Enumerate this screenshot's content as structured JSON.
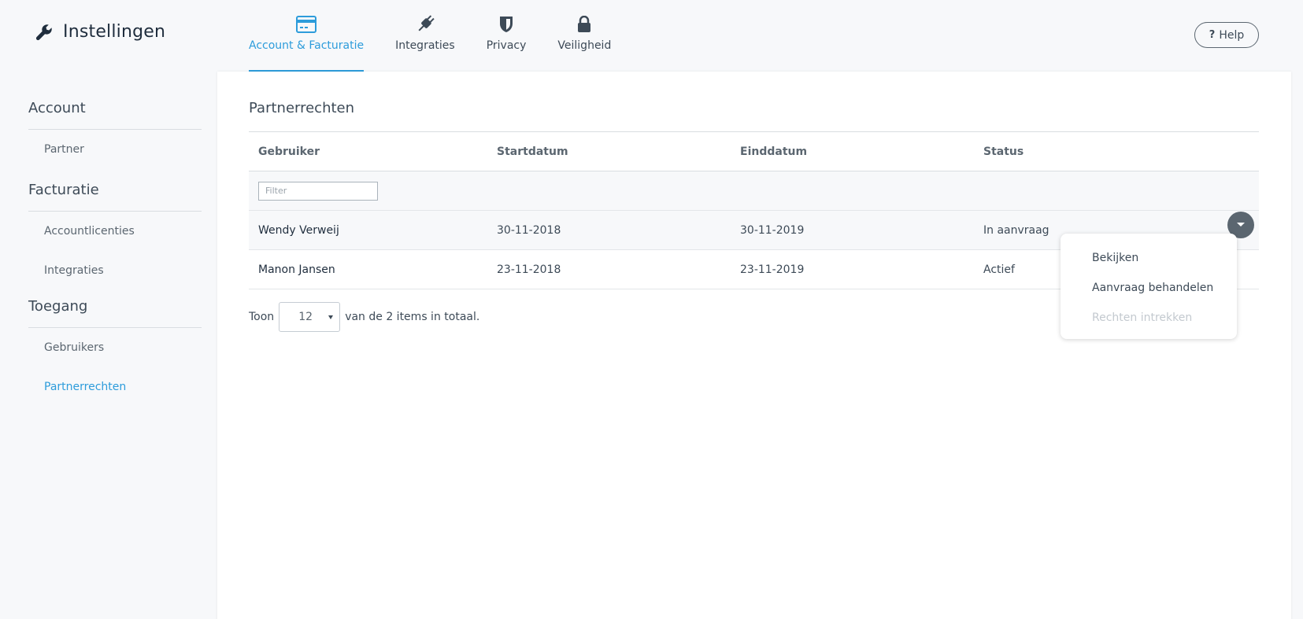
{
  "header": {
    "title": "Instellingen",
    "title_icon": "wrench-icon",
    "help_label": "Help",
    "tabs": [
      {
        "label": "Account & Facturatie",
        "icon": "credit-card-icon",
        "active": true
      },
      {
        "label": "Integraties",
        "icon": "plug-icon",
        "active": false
      },
      {
        "label": "Privacy",
        "icon": "shield-icon",
        "active": false
      },
      {
        "label": "Veiligheid",
        "icon": "lock-icon",
        "active": false
      }
    ]
  },
  "sidebar": {
    "sections": [
      {
        "title": "Account",
        "items": [
          {
            "label": "Partner",
            "active": false
          }
        ]
      },
      {
        "title": "Facturatie",
        "items": [
          {
            "label": "Accountlicenties",
            "active": false
          },
          {
            "label": "Integraties",
            "active": false
          }
        ]
      },
      {
        "title": "Toegang",
        "items": [
          {
            "label": "Gebruikers",
            "active": false
          },
          {
            "label": "Partnerrechten",
            "active": true
          }
        ]
      }
    ]
  },
  "main": {
    "title": "Partnerrechten",
    "table": {
      "columns": [
        "Gebruiker",
        "Startdatum",
        "Einddatum",
        "Status"
      ],
      "filter_placeholder": "Filter",
      "rows": [
        [
          "Wendy Verweij",
          "30-11-2018",
          "30-11-2019",
          "In aanvraag"
        ],
        [
          "Manon Jansen",
          "23-11-2018",
          "23-11-2019",
          "Actief"
        ]
      ]
    },
    "pager": {
      "show_label": "Toon",
      "page_size": "12",
      "total_text": "van de 2 items in totaal."
    },
    "row_menu": {
      "items": [
        {
          "label": "Bekijken",
          "disabled": false
        },
        {
          "label": "Aanvraag behandelen",
          "disabled": false
        },
        {
          "label": "Rechten intrekken",
          "disabled": true
        }
      ]
    }
  },
  "colors": {
    "accent": "#2d9cdb",
    "text": "#3d4a57",
    "background": "#f7f8fa",
    "action_button": "#5b6670"
  }
}
